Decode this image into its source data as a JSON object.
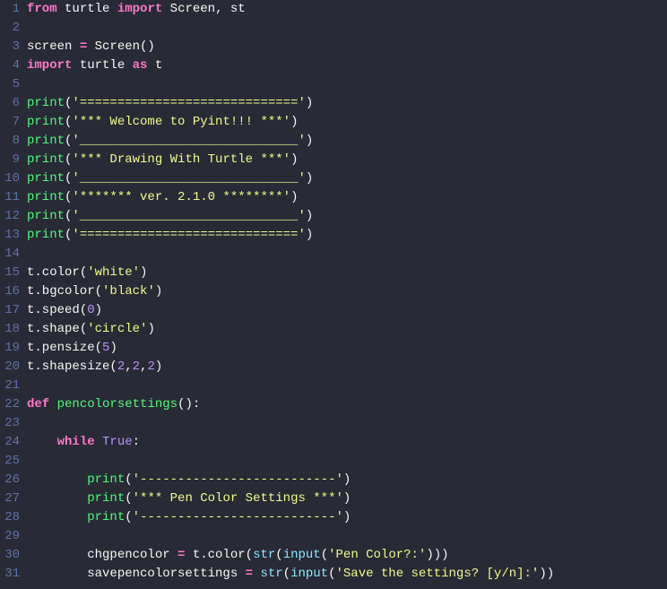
{
  "lines": [
    {
      "num": "1",
      "tokens": [
        {
          "t": "from",
          "c": "kw"
        },
        {
          "t": " ",
          "c": "var"
        },
        {
          "t": "turtle",
          "c": "var"
        },
        {
          "t": " ",
          "c": "var"
        },
        {
          "t": "import",
          "c": "kw"
        },
        {
          "t": " ",
          "c": "var"
        },
        {
          "t": "Screen, st",
          "c": "var"
        }
      ]
    },
    {
      "num": "2",
      "tokens": []
    },
    {
      "num": "3",
      "tokens": [
        {
          "t": "screen ",
          "c": "var"
        },
        {
          "t": "=",
          "c": "kw"
        },
        {
          "t": " Screen",
          "c": "var"
        },
        {
          "t": "()",
          "c": "punc"
        }
      ]
    },
    {
      "num": "4",
      "tokens": [
        {
          "t": "import",
          "c": "kw"
        },
        {
          "t": " ",
          "c": "var"
        },
        {
          "t": "turtle",
          "c": "var"
        },
        {
          "t": " ",
          "c": "var"
        },
        {
          "t": "as",
          "c": "kw"
        },
        {
          "t": " t",
          "c": "var"
        }
      ]
    },
    {
      "num": "5",
      "tokens": []
    },
    {
      "num": "6",
      "tokens": [
        {
          "t": "print",
          "c": "fn"
        },
        {
          "t": "(",
          "c": "punc"
        },
        {
          "t": "'============================='",
          "c": "str"
        },
        {
          "t": ")",
          "c": "punc"
        }
      ]
    },
    {
      "num": "7",
      "tokens": [
        {
          "t": "print",
          "c": "fn"
        },
        {
          "t": "(",
          "c": "punc"
        },
        {
          "t": "'*** Welcome to Pyint!!! ***'",
          "c": "str"
        },
        {
          "t": ")",
          "c": "punc"
        }
      ]
    },
    {
      "num": "8",
      "tokens": [
        {
          "t": "print",
          "c": "fn"
        },
        {
          "t": "(",
          "c": "punc"
        },
        {
          "t": "'_____________________________'",
          "c": "str"
        },
        {
          "t": ")",
          "c": "punc"
        }
      ]
    },
    {
      "num": "9",
      "tokens": [
        {
          "t": "print",
          "c": "fn"
        },
        {
          "t": "(",
          "c": "punc"
        },
        {
          "t": "'*** Drawing With Turtle ***'",
          "c": "str"
        },
        {
          "t": ")",
          "c": "punc"
        }
      ]
    },
    {
      "num": "10",
      "tokens": [
        {
          "t": "print",
          "c": "fn"
        },
        {
          "t": "(",
          "c": "punc"
        },
        {
          "t": "'_____________________________'",
          "c": "str"
        },
        {
          "t": ")",
          "c": "punc"
        }
      ]
    },
    {
      "num": "11",
      "tokens": [
        {
          "t": "print",
          "c": "fn"
        },
        {
          "t": "(",
          "c": "punc"
        },
        {
          "t": "'******* ver. 2.1.0 ********'",
          "c": "str"
        },
        {
          "t": ")",
          "c": "punc"
        }
      ]
    },
    {
      "num": "12",
      "tokens": [
        {
          "t": "print",
          "c": "fn"
        },
        {
          "t": "(",
          "c": "punc"
        },
        {
          "t": "'_____________________________'",
          "c": "str"
        },
        {
          "t": ")",
          "c": "punc"
        }
      ]
    },
    {
      "num": "13",
      "tokens": [
        {
          "t": "print",
          "c": "fn"
        },
        {
          "t": "(",
          "c": "punc"
        },
        {
          "t": "'============================='",
          "c": "str"
        },
        {
          "t": ")",
          "c": "punc"
        }
      ]
    },
    {
      "num": "14",
      "tokens": []
    },
    {
      "num": "15",
      "tokens": [
        {
          "t": "t.color",
          "c": "var"
        },
        {
          "t": "(",
          "c": "punc"
        },
        {
          "t": "'white'",
          "c": "str"
        },
        {
          "t": ")",
          "c": "punc"
        }
      ]
    },
    {
      "num": "16",
      "tokens": [
        {
          "t": "t.bgcolor",
          "c": "var"
        },
        {
          "t": "(",
          "c": "punc"
        },
        {
          "t": "'black'",
          "c": "str"
        },
        {
          "t": ")",
          "c": "punc"
        }
      ]
    },
    {
      "num": "17",
      "tokens": [
        {
          "t": "t.speed",
          "c": "var"
        },
        {
          "t": "(",
          "c": "punc"
        },
        {
          "t": "0",
          "c": "num"
        },
        {
          "t": ")",
          "c": "punc"
        }
      ]
    },
    {
      "num": "18",
      "tokens": [
        {
          "t": "t.shape",
          "c": "var"
        },
        {
          "t": "(",
          "c": "punc"
        },
        {
          "t": "'circle'",
          "c": "str"
        },
        {
          "t": ")",
          "c": "punc"
        }
      ]
    },
    {
      "num": "19",
      "tokens": [
        {
          "t": "t.pensize",
          "c": "var"
        },
        {
          "t": "(",
          "c": "punc"
        },
        {
          "t": "5",
          "c": "num"
        },
        {
          "t": ")",
          "c": "punc"
        }
      ]
    },
    {
      "num": "20",
      "tokens": [
        {
          "t": "t.shapesize",
          "c": "var"
        },
        {
          "t": "(",
          "c": "punc"
        },
        {
          "t": "2",
          "c": "num"
        },
        {
          "t": ",",
          "c": "punc"
        },
        {
          "t": "2",
          "c": "num"
        },
        {
          "t": ",",
          "c": "punc"
        },
        {
          "t": "2",
          "c": "num"
        },
        {
          "t": ")",
          "c": "punc"
        }
      ]
    },
    {
      "num": "21",
      "tokens": []
    },
    {
      "num": "22",
      "tokens": [
        {
          "t": "def",
          "c": "def"
        },
        {
          "t": " ",
          "c": "var"
        },
        {
          "t": "pencolorsettings",
          "c": "funcname"
        },
        {
          "t": "():",
          "c": "punc"
        }
      ]
    },
    {
      "num": "23",
      "tokens": []
    },
    {
      "num": "24",
      "tokens": [
        {
          "t": "    ",
          "c": "var"
        },
        {
          "t": "while",
          "c": "kw"
        },
        {
          "t": " ",
          "c": "var"
        },
        {
          "t": "True",
          "c": "bool"
        },
        {
          "t": ":",
          "c": "punc"
        }
      ]
    },
    {
      "num": "25",
      "tokens": []
    },
    {
      "num": "26",
      "tokens": [
        {
          "t": "        ",
          "c": "var"
        },
        {
          "t": "print",
          "c": "fn"
        },
        {
          "t": "(",
          "c": "punc"
        },
        {
          "t": "'--------------------------'",
          "c": "str"
        },
        {
          "t": ")",
          "c": "punc"
        }
      ]
    },
    {
      "num": "27",
      "tokens": [
        {
          "t": "        ",
          "c": "var"
        },
        {
          "t": "print",
          "c": "fn"
        },
        {
          "t": "(",
          "c": "punc"
        },
        {
          "t": "'*** Pen Color Settings ***'",
          "c": "str"
        },
        {
          "t": ")",
          "c": "punc"
        }
      ]
    },
    {
      "num": "28",
      "tokens": [
        {
          "t": "        ",
          "c": "var"
        },
        {
          "t": "print",
          "c": "fn"
        },
        {
          "t": "(",
          "c": "punc"
        },
        {
          "t": "'--------------------------'",
          "c": "str"
        },
        {
          "t": ")",
          "c": "punc"
        }
      ]
    },
    {
      "num": "29",
      "tokens": []
    },
    {
      "num": "30",
      "tokens": [
        {
          "t": "        chgpencolor ",
          "c": "var"
        },
        {
          "t": "=",
          "c": "kw"
        },
        {
          "t": " t.color",
          "c": "var"
        },
        {
          "t": "(",
          "c": "punc"
        },
        {
          "t": "str",
          "c": "builtin"
        },
        {
          "t": "(",
          "c": "punc"
        },
        {
          "t": "input",
          "c": "builtin"
        },
        {
          "t": "(",
          "c": "punc"
        },
        {
          "t": "'Pen Color?:'",
          "c": "str"
        },
        {
          "t": ")))",
          "c": "punc"
        }
      ]
    },
    {
      "num": "31",
      "tokens": [
        {
          "t": "        savepencolorsettings ",
          "c": "var"
        },
        {
          "t": "=",
          "c": "kw"
        },
        {
          "t": " ",
          "c": "var"
        },
        {
          "t": "str",
          "c": "builtin"
        },
        {
          "t": "(",
          "c": "punc"
        },
        {
          "t": "input",
          "c": "builtin"
        },
        {
          "t": "(",
          "c": "punc"
        },
        {
          "t": "'Save the settings? [y/n]:'",
          "c": "str"
        },
        {
          "t": "))",
          "c": "punc"
        }
      ]
    }
  ]
}
